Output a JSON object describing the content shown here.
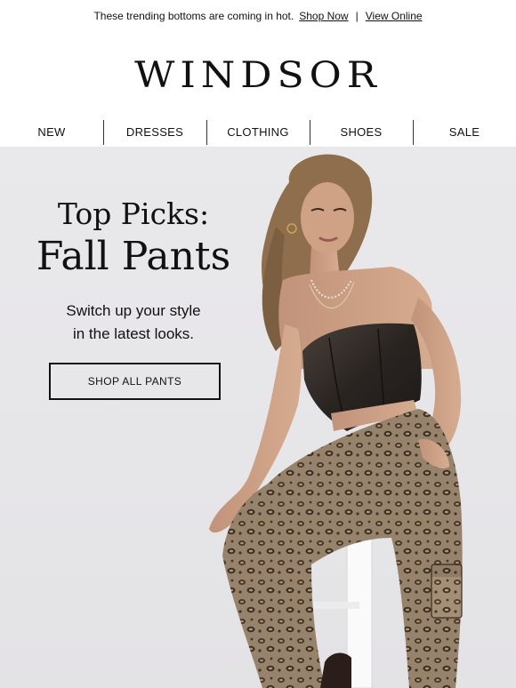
{
  "preheader": {
    "text": "These trending bottoms are coming in hot.",
    "shop_now": "Shop Now",
    "separator": "|",
    "view_online": "View Online"
  },
  "brand": {
    "logo_text": "WINDSOR"
  },
  "nav": {
    "items": [
      "NEW",
      "DRESSES",
      "CLOTHING",
      "SHOES",
      "SALE"
    ]
  },
  "hero": {
    "kicker": "Top Picks:",
    "title": "Fall Pants",
    "subtitle": "Switch up your style\nin the latest looks.",
    "cta_label": "SHOP ALL PANTS",
    "image_description": "model-in-leather-corset-and-leopard-print-pants",
    "colors": {
      "background": "#e7e6e9",
      "corset": "#2b2624",
      "pants": "#9a8670",
      "skin": "#c99c80",
      "hair": "#9a7a55",
      "stool": "#f4f4f4"
    }
  }
}
